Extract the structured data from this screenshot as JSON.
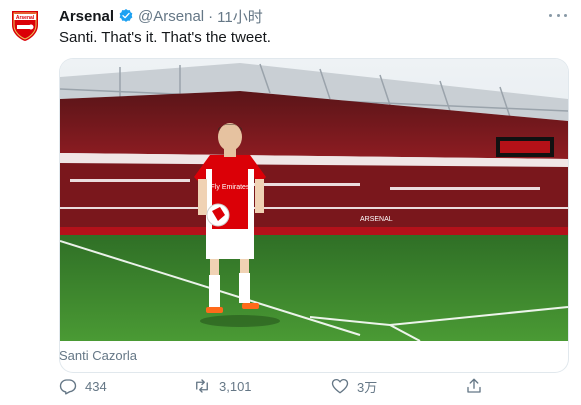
{
  "tweet": {
    "author_name": "Arsenal",
    "handle": "@Arsenal",
    "separator": "·",
    "time": "11小时",
    "text": "Santi. That's it. That's the tweet.",
    "avatar_text": "Arsenal",
    "media_caption": "Santi Cazorla",
    "shirt_text": "Fly Emirates",
    "stands_text": "ARSENAL"
  },
  "actions": {
    "reply_count": "434",
    "retweet_count": "3,101",
    "like_count": "3万"
  },
  "colors": {
    "arsenal_red": "#db0007",
    "verified_blue": "#1da1f2",
    "secondary_text": "#657786",
    "pitch_green": "#3f8a2c"
  }
}
